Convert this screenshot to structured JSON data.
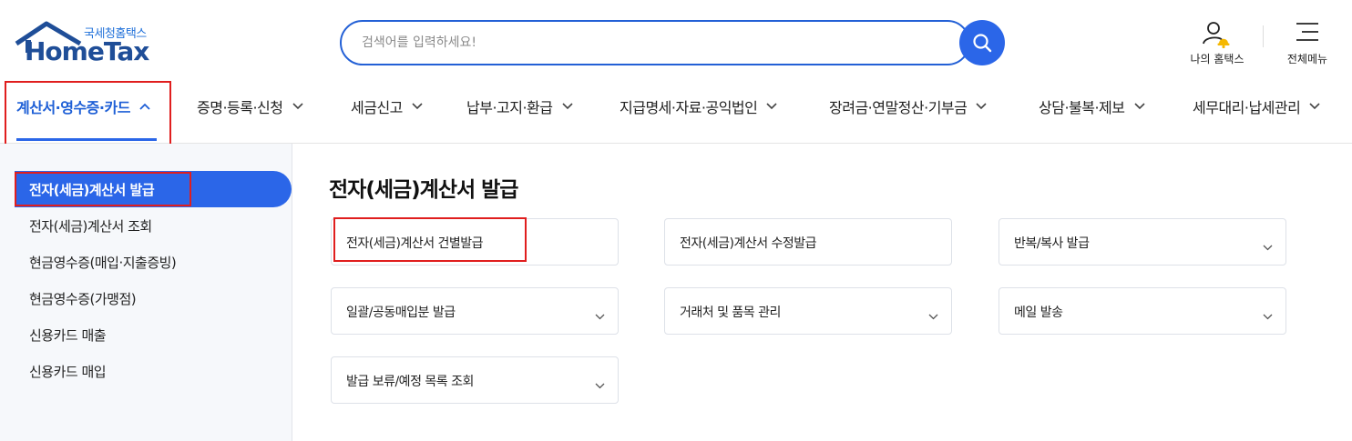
{
  "logo": {
    "sub": "국세청홈택스",
    "main": "HomeTax"
  },
  "search": {
    "placeholder": "검색어를 입력하세요!"
  },
  "header": {
    "myhome_label": "나의 홈택스",
    "allmenu_label": "전체메뉴"
  },
  "gnb": {
    "items": [
      "계산서·영수증·카드",
      "증명·등록·신청",
      "세금신고",
      "납부·고지·환급",
      "지급명세·자료·공익법인",
      "장려금·연말정산·기부금",
      "상담·불복·제보",
      "세무대리·납세관리"
    ]
  },
  "lnb": {
    "items": [
      "전자(세금)계산서 발급",
      "전자(세금)계산서 조회",
      "현금영수증(매입·지출증빙)",
      "현금영수증(가맹점)",
      "신용카드 매출",
      "신용카드 매입"
    ]
  },
  "content": {
    "title": "전자(세금)계산서 발급",
    "cards": [
      "전자(세금)계산서 건별발급",
      "전자(세금)계산서 수정발급",
      "반복/복사 발급",
      "일괄/공동매입분 발급",
      "거래처 및 품목 관리",
      "메일 발송",
      "발급 보류/예정 목록 조회"
    ]
  },
  "colors": {
    "primary": "#2b66e8",
    "brand": "#1f4e98",
    "highlight_box": "#e01e1e"
  }
}
